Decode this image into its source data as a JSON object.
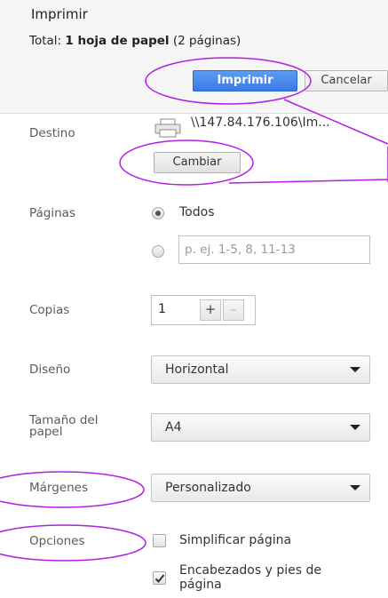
{
  "dialog": {
    "title": "Imprimir",
    "total_label": "Total:",
    "total_bold": "1 hoja de papel",
    "total_rest": "(2 páginas)",
    "print_button": "Imprimir",
    "cancel_button": "Cancelar"
  },
  "destination": {
    "label": "Destino",
    "printer_name": "\\\\147.84.176.106\\Im...",
    "change_button": "Cambiar"
  },
  "pages": {
    "label": "Páginas",
    "all_option": "Todos",
    "all_selected": true,
    "range_placeholder": "p. ej. 1-5, 8, 11-13"
  },
  "copies": {
    "label": "Copias",
    "value": "1",
    "plus": "+",
    "minus": "–"
  },
  "layout": {
    "label": "Diseño",
    "value": "Horizontal"
  },
  "paper_size": {
    "label_line1": "Tamaño del",
    "label_line2": "papel",
    "value": "A4"
  },
  "margins": {
    "label": "Márgenes",
    "value": "Personalizado"
  },
  "options": {
    "label": "Opciones",
    "simplify_page": "Simplificar página",
    "simplify_checked": false,
    "headers_footers_line1": "Encabezados y pies de",
    "headers_footers_line2": "página",
    "headers_footers_checked": true
  },
  "colors": {
    "primary_button": "#3a7ae6",
    "annotation": "#b31ee6"
  }
}
